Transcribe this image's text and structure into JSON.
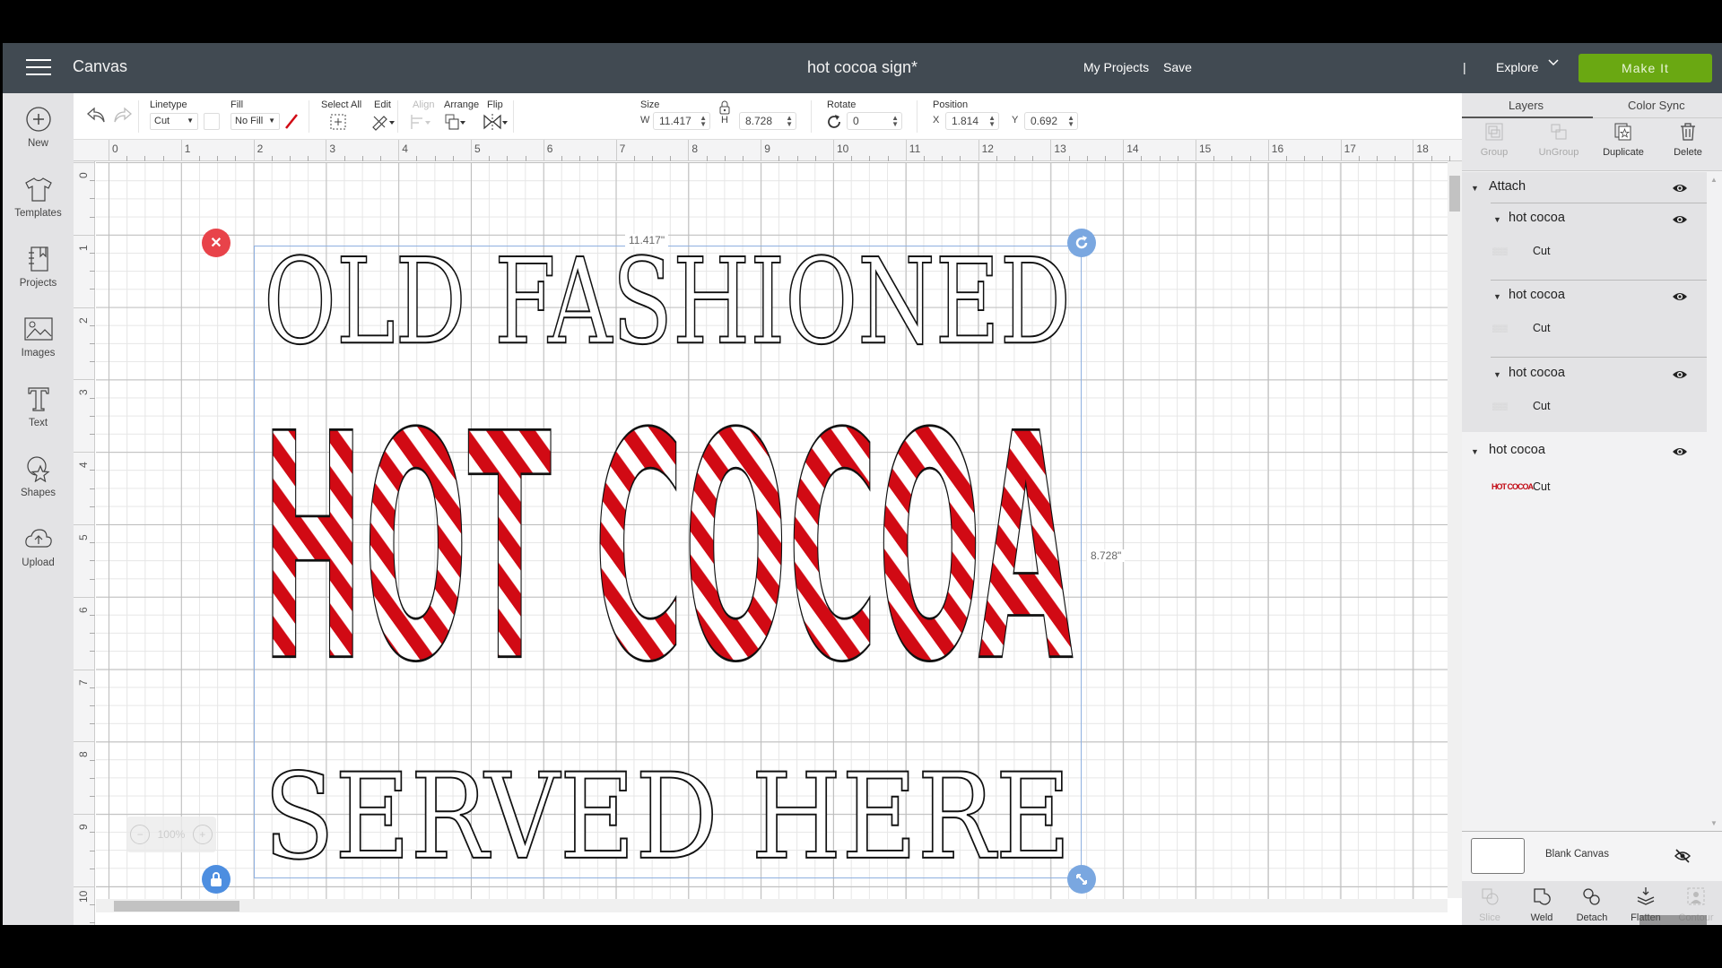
{
  "header": {
    "menu_icon": "hamburger-icon",
    "app_title": "Canvas",
    "document_title": "hot cocoa sign*",
    "links": {
      "my_projects": "My Projects",
      "save": "Save",
      "separator": "|",
      "explore": "Explore"
    },
    "make_it": "Make It",
    "colors": {
      "header_bg": "#414a52",
      "make_it_bg": "#6aa812"
    }
  },
  "sidebar": {
    "items": [
      {
        "label": "New",
        "icon": "plus-circle-icon"
      },
      {
        "label": "Templates",
        "icon": "tshirt-icon"
      },
      {
        "label": "Projects",
        "icon": "notebook-icon"
      },
      {
        "label": "Images",
        "icon": "image-icon"
      },
      {
        "label": "Text",
        "icon": "text-icon"
      },
      {
        "label": "Shapes",
        "icon": "shapes-icon"
      },
      {
        "label": "Upload",
        "icon": "cloud-upload-icon"
      }
    ]
  },
  "toolbar": {
    "undo_icon": "undo-icon",
    "redo_icon": "redo-icon",
    "linetype": {
      "label": "Linetype",
      "value": "Cut"
    },
    "fill": {
      "label": "Fill",
      "value": "No Fill"
    },
    "select_all": "Select All",
    "edit": "Edit",
    "align": "Align",
    "arrange": "Arrange",
    "flip": "Flip",
    "size": {
      "label": "Size",
      "w_label": "W",
      "w": "11.417",
      "h_label": "H",
      "h": "8.728"
    },
    "rotate": {
      "label": "Rotate",
      "value": "0"
    },
    "position": {
      "label": "Position",
      "x_label": "X",
      "x": "1.814",
      "y_label": "Y",
      "y": "0.692"
    }
  },
  "canvas": {
    "ruler_top": [
      "0",
      "1",
      "2",
      "3",
      "4",
      "5",
      "6",
      "7",
      "8",
      "9",
      "10",
      "11",
      "12",
      "13",
      "14",
      "15",
      "16",
      "17",
      "18"
    ],
    "ruler_left": [
      "0",
      "1",
      "2",
      "3",
      "4",
      "5",
      "6",
      "7",
      "8",
      "9",
      "10"
    ],
    "width_label": "11.417\"",
    "height_label": "8.728\"",
    "zoom": "100%",
    "design": {
      "line1": "OLD FASHIONED",
      "line2": "HOT COCOA",
      "line3": "SERVED HERE",
      "stripe_color": "#d10a14"
    }
  },
  "panel": {
    "tabs": [
      "Layers",
      "Color Sync"
    ],
    "actions": [
      {
        "label": "Group",
        "enabled": false
      },
      {
        "label": "UnGroup",
        "enabled": false
      },
      {
        "label": "Duplicate",
        "enabled": true
      },
      {
        "label": "Delete",
        "enabled": true
      }
    ],
    "layers": {
      "attach": "Attach",
      "children": [
        {
          "name": "hot cocoa",
          "type": "Cut"
        },
        {
          "name": "hot cocoa",
          "type": "Cut"
        },
        {
          "name": "hot cocoa",
          "type": "Cut"
        }
      ],
      "standalone": {
        "name": "hot cocoa",
        "type": "Cut",
        "thumb": "HOT COCOA"
      }
    },
    "blank_canvas": "Blank Canvas",
    "bottom_actions": [
      {
        "label": "Slice",
        "enabled": false
      },
      {
        "label": "Weld",
        "enabled": true
      },
      {
        "label": "Detach",
        "enabled": true
      },
      {
        "label": "Flatten",
        "enabled": true
      },
      {
        "label": "Contour",
        "enabled": false
      }
    ]
  }
}
